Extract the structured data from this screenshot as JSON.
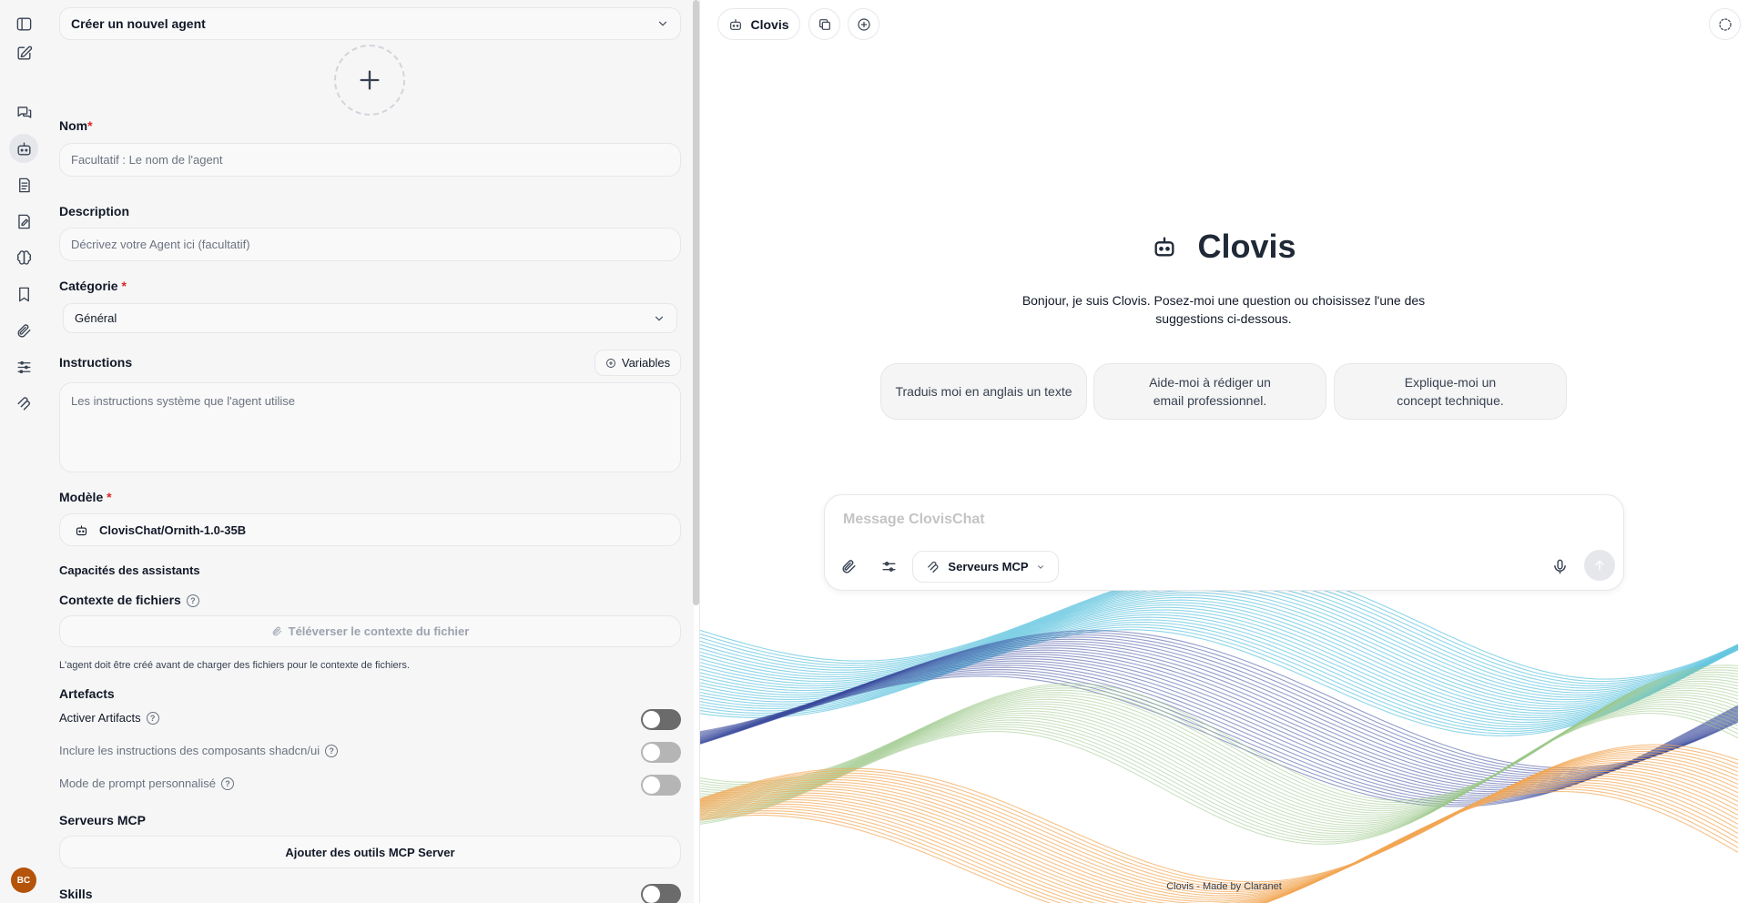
{
  "sidebar": {
    "icons": [
      "sidebar-toggle-icon",
      "new-chat-icon",
      "chats-icon",
      "agent-icon",
      "prompts-icon",
      "memories-icon",
      "brain-icon",
      "bookmark-icon",
      "attachment-icon",
      "settings-sliders-icon",
      "mcp-icon"
    ],
    "active": "agent-icon",
    "avatar_initials": "BC",
    "avatar_color": "#b45309"
  },
  "agent_panel": {
    "agent_select": "Créer un nouvel agent",
    "name_label": "Nom",
    "required_mark": "*",
    "name_placeholder": "Facultatif : Le nom de l'agent",
    "description_label": "Description",
    "description_placeholder": "Décrivez votre Agent ici (facultatif)",
    "category_label": "Catégorie",
    "category_value": "Général",
    "instructions_label": "Instructions",
    "variables_button": "Variables",
    "instructions_placeholder": "Les instructions système que l'agent utilise",
    "model_label": "Modèle",
    "model_value": "ClovisChat/Ornith-1.0-35B",
    "capabilities_label": "Capacités des assistants",
    "file_context_label": "Contexte de fichiers",
    "upload_button": "Téléverser le contexte du fichier",
    "upload_note": "L'agent doit être créé avant de charger des fichiers pour le contexte de fichiers.",
    "artifacts_label": "Artefacts",
    "toggles": [
      {
        "label": "Activer Artifacts",
        "on": false
      },
      {
        "label": "Inclure les instructions des composants shadcn/ui",
        "on": false
      },
      {
        "label": "Mode de prompt personnalisé",
        "on": false
      }
    ],
    "mcp_label": "Serveurs MCP",
    "mcp_button": "Ajouter des outils MCP Server",
    "skills_label": "Skills",
    "skills_on": false
  },
  "main": {
    "top_chip_label": "Clovis",
    "hero_title": "Clovis",
    "intro_text": "Bonjour, je suis Clovis. Posez-moi une question ou choisissez l'une des suggestions ci-dessous.",
    "suggestions": [
      "Traduis moi en anglais un texte",
      "Aide-moi à rédiger un email professionnel.",
      "Explique-moi un concept technique."
    ],
    "composer_placeholder": "Message ClovisChat",
    "mcp_chip": "Serveurs MCP",
    "footer": "Clovis - Made by Claranet"
  },
  "colors": {
    "required": "#dc2626",
    "wave_blue": "#67c7e0",
    "wave_orange": "#f2a654",
    "wave_navy": "#3b4a9c",
    "wave_green": "#9cc98a"
  }
}
